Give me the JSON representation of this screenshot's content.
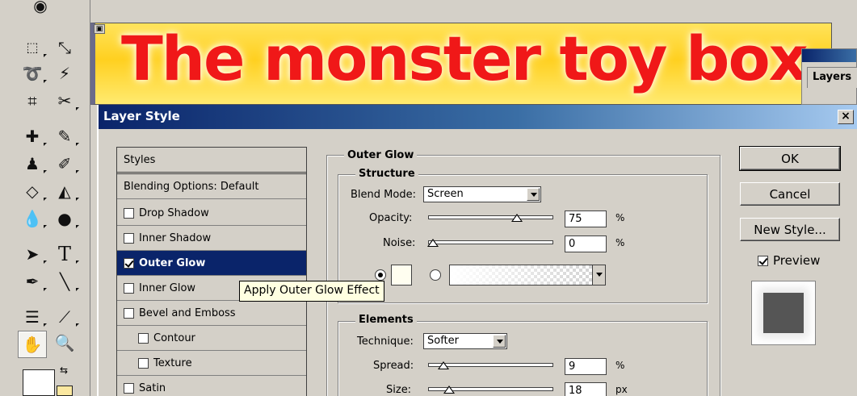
{
  "document": {
    "headline": "The monster toy box",
    "background_color": "#ffd020",
    "headline_color": "#f01818"
  },
  "layers_palette": {
    "tab_label": "Layers"
  },
  "dialog": {
    "title": "Layer Style",
    "close_label": "×"
  },
  "styles_list": {
    "header": "Styles",
    "blending": "Blending Options: Default",
    "items": [
      {
        "label": "Drop Shadow",
        "checked": false
      },
      {
        "label": "Inner Shadow",
        "checked": false
      },
      {
        "label": "Outer Glow",
        "checked": true,
        "selected": true
      },
      {
        "label": "Inner Glow",
        "checked": false
      },
      {
        "label": "Bevel and Emboss",
        "checked": false
      },
      {
        "label": "Contour",
        "checked": false
      },
      {
        "label": "Texture",
        "checked": false
      },
      {
        "label": "Satin",
        "checked": false
      }
    ]
  },
  "tooltip": "Apply Outer Glow Effect",
  "outer_glow": {
    "title": "Outer Glow",
    "structure": {
      "title": "Structure",
      "blend_mode_label": "Blend Mode:",
      "blend_mode_value": "Screen",
      "opacity_label": "Opacity:",
      "opacity_value": "75",
      "opacity_unit": "%",
      "opacity_fraction": 0.75,
      "noise_label": "Noise:",
      "noise_value": "0",
      "noise_unit": "%",
      "noise_fraction": 0,
      "glow_color": "#fffef0"
    },
    "elements": {
      "title": "Elements",
      "technique_label": "Technique:",
      "technique_value": "Softer",
      "spread_label": "Spread:",
      "spread_value": "9",
      "spread_unit": "%",
      "spread_fraction": 0.09,
      "size_label": "Size:",
      "size_value": "18",
      "size_unit": "px"
    }
  },
  "buttons": {
    "ok": "OK",
    "cancel": "Cancel",
    "new_style": "New Style...",
    "preview_label": "Preview",
    "preview_checked": true
  },
  "colors": {
    "titlebar_start": "#0a246a",
    "titlebar_end": "#a6caf0",
    "selection": "#0a246a",
    "dialog_face": "#d4d0c8",
    "tooltip_bg": "#ffffe1"
  }
}
